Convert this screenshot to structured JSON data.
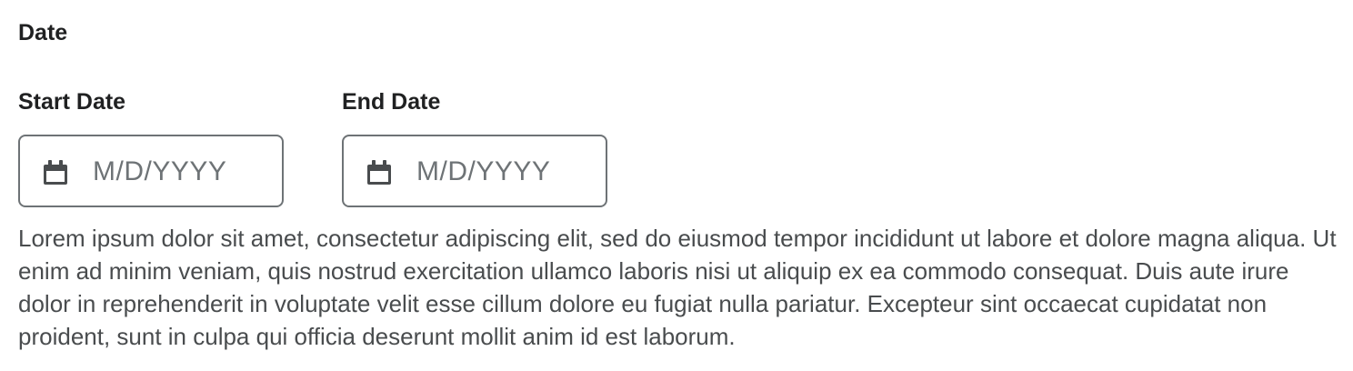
{
  "section": {
    "title": "Date"
  },
  "start_date": {
    "label": "Start Date",
    "placeholder": "M/D/YYYY",
    "icon": "calendar-icon"
  },
  "end_date": {
    "label": "End Date",
    "placeholder": "M/D/YYYY",
    "icon": "calendar-icon"
  },
  "description": "Lorem ipsum dolor sit amet, consectetur adipiscing elit, sed do eiusmod tempor incididunt ut labore et dolore magna aliqua. Ut enim ad minim veniam, quis nostrud exercitation ullamco laboris nisi ut aliquip ex ea commodo consequat. Duis aute irure dolor in reprehenderit in voluptate velit esse cillum dolore eu fugiat nulla pariatur. Excepteur sint occaecat cupidatat non proident, sunt in culpa qui officia deserunt mollit anim id est laborum.",
  "colors": {
    "text": "#202122",
    "muted": "#6e7376",
    "border": "#6e7376",
    "icon": "#494c4e"
  }
}
